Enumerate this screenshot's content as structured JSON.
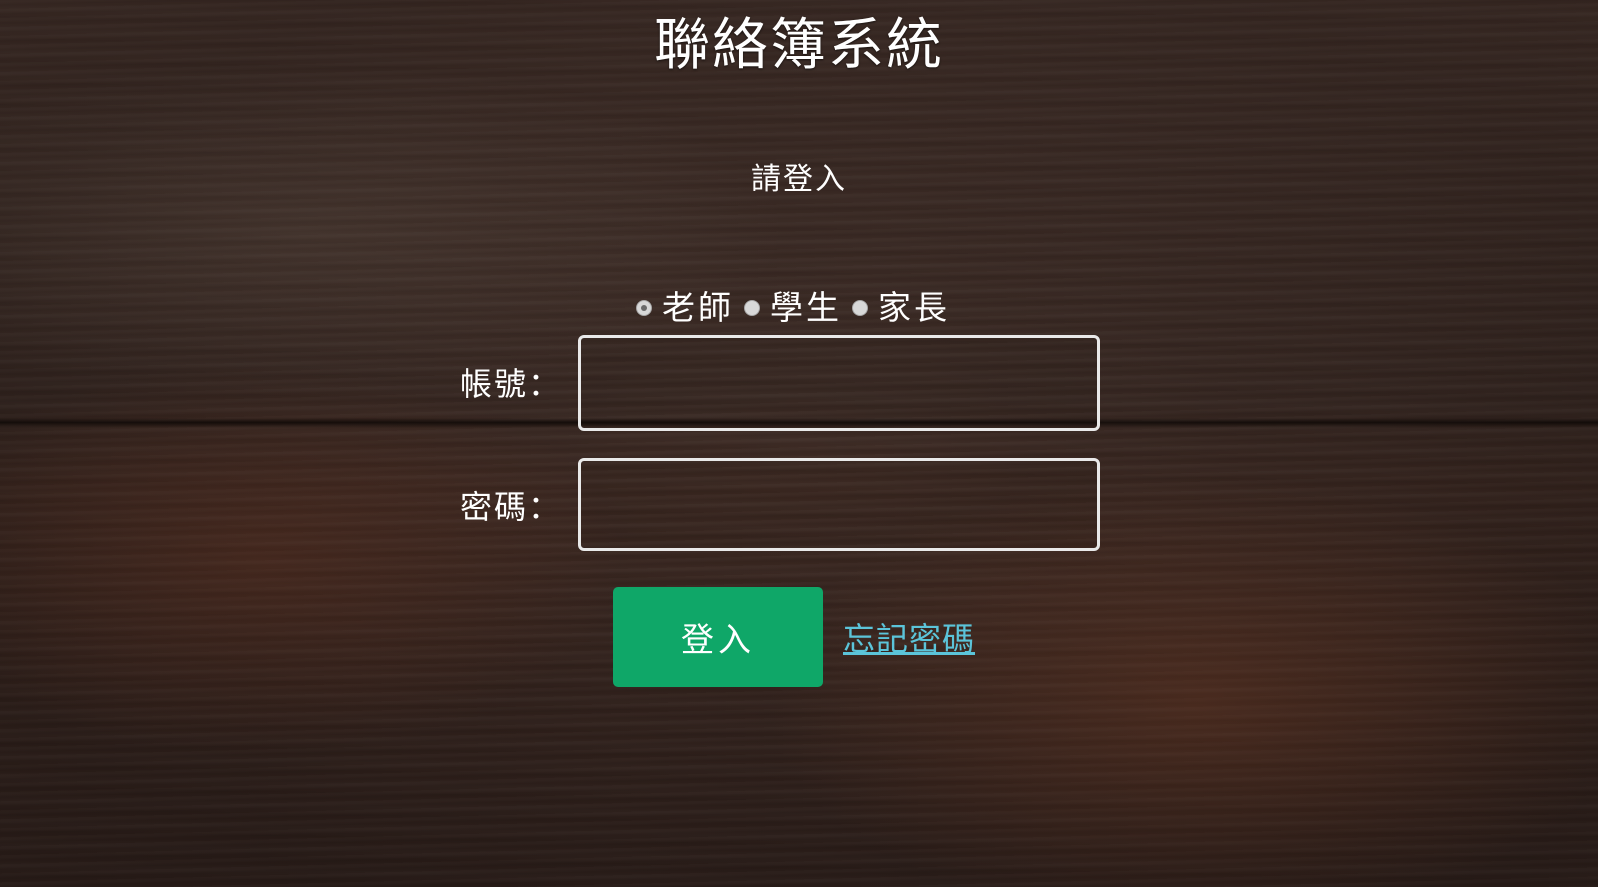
{
  "app": {
    "title": "聯絡簿系統"
  },
  "login": {
    "prompt": "請登入",
    "roles": [
      {
        "label": "老師",
        "selected": true
      },
      {
        "label": "學生",
        "selected": false
      },
      {
        "label": "家長",
        "selected": false
      }
    ],
    "account_label": "帳號：",
    "account_value": "",
    "password_label": "密碼：",
    "password_value": "",
    "submit_label": "登入",
    "forgot_label": "忘記密碼"
  },
  "colors": {
    "accent": "#0fa768",
    "link": "#5bc4d9",
    "background": "#3a2720"
  },
  "icons": {
    "radio": "radio-button-icon"
  }
}
